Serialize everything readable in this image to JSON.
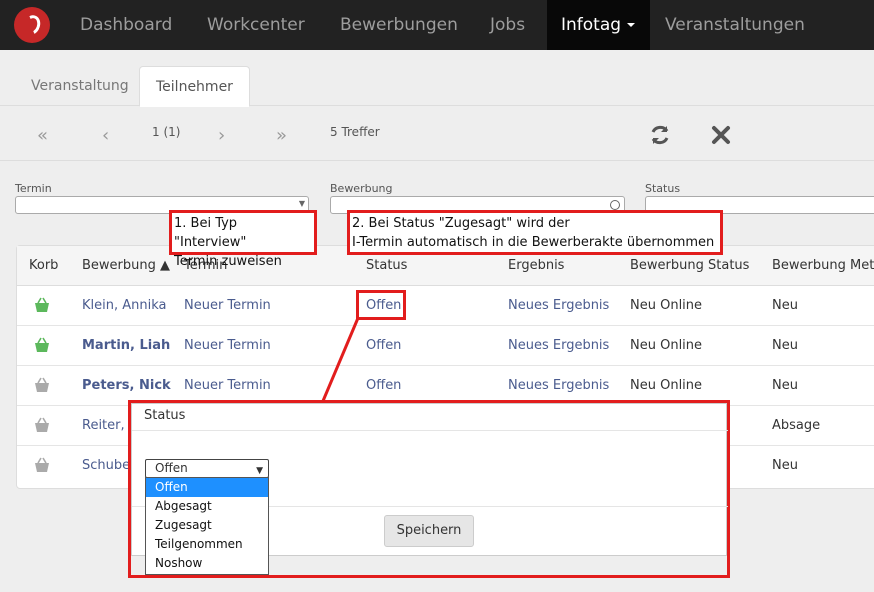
{
  "nav": {
    "items": [
      "Dashboard",
      "Workcenter",
      "Bewerbungen",
      "Jobs",
      "Infotag",
      "Veranstaltungen"
    ],
    "active": "Infotag"
  },
  "tabs": [
    "Veranstaltung",
    "Teilnehmer"
  ],
  "pager": {
    "page": "1 (1)",
    "hits": "5 Treffer"
  },
  "filters": [
    "Termin",
    "Bewerbung",
    "Status"
  ],
  "table": {
    "headers": [
      "Korb",
      "Bewerbung ▲",
      "Termin",
      "Status",
      "Ergebnis",
      "Bewerbung Status",
      "Bewerbung Meta"
    ],
    "rows": [
      {
        "name": "Klein, Annika",
        "termin": "Neuer Termin",
        "status": "Offen",
        "ergebnis": "Neues Ergebnis",
        "bstatus": "Neu Online",
        "meta": "Neu"
      },
      {
        "name": "Martin, Liah",
        "termin": "Neuer Termin",
        "status": "Offen",
        "ergebnis": "Neues Ergebnis",
        "bstatus": "Neu Online",
        "meta": "Neu"
      },
      {
        "name": "Peters, Nick",
        "termin": "Neuer Termin",
        "status": "Offen",
        "ergebnis": "Neues Ergebnis",
        "bstatus": "Neu Online",
        "meta": "Neu"
      },
      {
        "name": "Reiter, M",
        "meta": "Absage"
      },
      {
        "name": "Schuber",
        "meta": "Neu"
      }
    ]
  },
  "annotations": {
    "a1": [
      "1. Bei Typ \"Interview\"",
      "Termin zuweisen"
    ],
    "a2": [
      "2. Bei Status \"Zugesagt\" wird der",
      "I-Termin automatisch in die Bewerberakte übernommen"
    ]
  },
  "modal": {
    "title": "Status",
    "selected": "Offen",
    "options": [
      "Offen",
      "Abgesagt",
      "Zugesagt",
      "Teilgenommen",
      "Noshow"
    ],
    "save_label": "Speichern"
  },
  "colors": {
    "annotation": "#e21d1d",
    "link": "#4a5b8e",
    "basket_active": "#5cb85c",
    "basket_inactive": "#aaaaaa",
    "option_selected": "#1e90ff"
  }
}
